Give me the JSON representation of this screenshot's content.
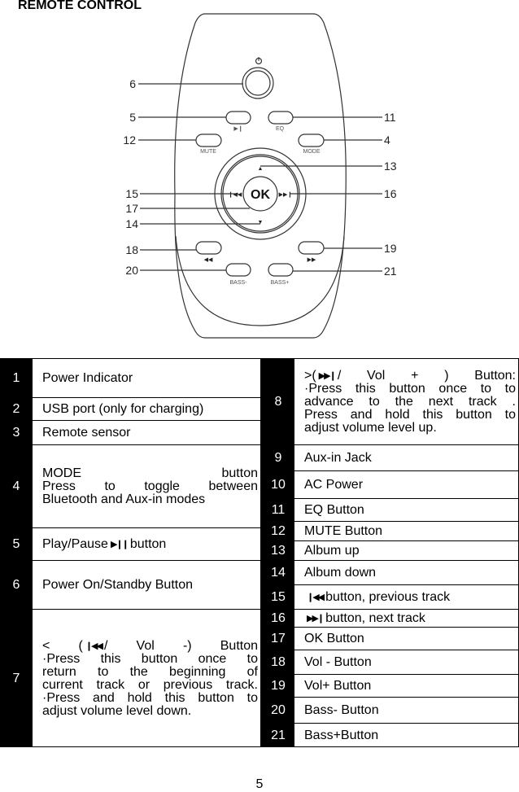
{
  "title": "REMOTE CONTROL",
  "figure": {
    "callouts_left": [
      "6",
      "5",
      "12",
      "15",
      "17",
      "14",
      "18",
      "20"
    ],
    "callouts_right": [
      "11",
      "4",
      "13",
      "16",
      "19",
      "21"
    ],
    "button_labels": {
      "eq": "EQ",
      "mute": "MUTE",
      "mode": "MODE",
      "ok": "OK",
      "bass_minus": "BASS-",
      "bass_plus": "BASS+"
    }
  },
  "left_rows": [
    {
      "num": "1",
      "lines": [
        {
          "pre": "Power Indicator"
        }
      ]
    },
    {
      "num": "2",
      "lines": [
        {
          "pre": "USB port (only for charging)"
        }
      ]
    },
    {
      "num": "3",
      "lines": [
        {
          "pre": "Remote sensor"
        }
      ]
    },
    {
      "num": "4",
      "lines": [
        {
          "pre": "MODE button"
        },
        {
          "pre": "Press to toggle between"
        },
        {
          "pre": "Bluetooth and Aux-in modes"
        }
      ]
    },
    {
      "num": "5",
      "lines": [
        {
          "pre": "Play/Pause",
          "icon": "play-pause",
          "post": "button"
        }
      ]
    },
    {
      "num": "6",
      "lines": [
        {
          "pre": "Power On/Standby Button"
        }
      ]
    },
    {
      "num": "7",
      "lines": [
        {
          "pre": "< (",
          "icon": "previous",
          "post": "/ Vol -) Button"
        },
        {
          "pre": "·Press this button once to"
        },
        {
          "pre": "return to the beginning of"
        },
        {
          "pre": "current track or previous track."
        },
        {
          "pre": "·Press and hold this button to"
        },
        {
          "pre": "adjust volume level down."
        }
      ]
    }
  ],
  "right_rows": [
    {
      "num": "8",
      "lines": [
        {
          "pre": ">(",
          "icon": "next",
          "post": "/ Vol + ) Button:"
        },
        {
          "pre": "·Press this button once to to"
        },
        {
          "pre": "advance to the next track ."
        },
        {
          "pre": "Press and hold this button to"
        },
        {
          "pre": "adjust volume level up."
        }
      ]
    },
    {
      "num": "9",
      "lines": [
        {
          "pre": "Aux-in Jack"
        }
      ]
    },
    {
      "num": "10",
      "lines": [
        {
          "pre": "AC Power"
        }
      ]
    },
    {
      "num": "11",
      "lines": [
        {
          "pre": "EQ Button"
        }
      ]
    },
    {
      "num": "12",
      "lines": [
        {
          "pre": "MUTE Button"
        }
      ]
    },
    {
      "num": "13",
      "lines": [
        {
          "pre": "Album up"
        }
      ]
    },
    {
      "num": "14",
      "lines": [
        {
          "pre": "Album down"
        }
      ]
    },
    {
      "num": "15",
      "lines": [
        {
          "icon": "previous",
          "post": "button, previous track"
        }
      ]
    },
    {
      "num": "16",
      "lines": [
        {
          "icon": "next",
          "post": "button, next track"
        }
      ]
    },
    {
      "num": "17",
      "lines": [
        {
          "pre": "OK Button"
        }
      ]
    },
    {
      "num": "18",
      "lines": [
        {
          "pre": "Vol - Button"
        }
      ]
    },
    {
      "num": "19",
      "lines": [
        {
          "pre": "Vol+ Button"
        }
      ]
    },
    {
      "num": "20",
      "lines": [
        {
          "pre": "Bass- Button"
        }
      ]
    },
    {
      "num": "21",
      "lines": [
        {
          "pre": "Bass+Button"
        }
      ]
    }
  ],
  "page_number": "5"
}
